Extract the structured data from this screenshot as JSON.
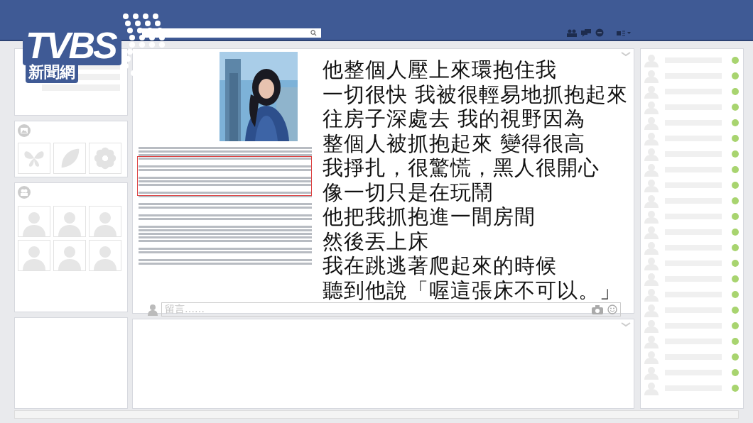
{
  "logo": {
    "brand": "TVBS",
    "subtitle": "新聞網"
  },
  "post": {
    "lines": [
      "他整個人壓上來環抱住我",
      "一切很快 我被很輕易地抓抱起來",
      "往房子深處去 我的視野因為",
      "整個人被抓抱起來 變得很高",
      "我掙扎，很驚慌，黑人很開心",
      "像一切只是在玩鬧",
      "他把我抓抱進一間房間",
      "然後丟上床",
      "我在跳逃著爬起來的時候",
      "聽到他說「喔這張床不可以。」"
    ]
  },
  "comment": {
    "placeholder": "留言……"
  }
}
